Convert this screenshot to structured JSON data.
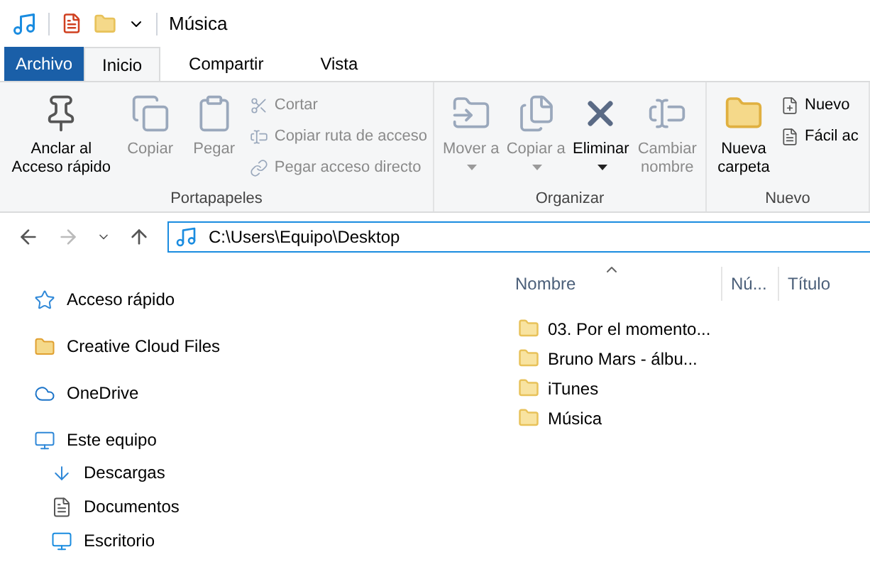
{
  "window": {
    "title": "Música"
  },
  "tabs": [
    {
      "label": "Archivo",
      "kind": "file",
      "selected": false
    },
    {
      "label": "Inicio",
      "kind": "tab",
      "selected": true
    },
    {
      "label": "Compartir",
      "kind": "tab",
      "selected": false
    },
    {
      "label": "Vista",
      "kind": "tab",
      "selected": false
    }
  ],
  "ribbon": {
    "groups": [
      {
        "label": "Portapapeles",
        "large": [
          {
            "label": "Anclar al Acceso rápido",
            "disabled": false
          },
          {
            "label": "Copiar",
            "disabled": true
          },
          {
            "label": "Pegar",
            "disabled": true
          }
        ],
        "small": [
          {
            "label": "Cortar",
            "disabled": true
          },
          {
            "label": "Copiar ruta de acceso",
            "disabled": true
          },
          {
            "label": "Pegar acceso directo",
            "disabled": true
          }
        ]
      },
      {
        "label": "Organizar",
        "large": [
          {
            "label": "Mover a",
            "disabled": true,
            "dropdown": true
          },
          {
            "label": "Copiar a",
            "disabled": true,
            "dropdown": true
          },
          {
            "label": "Eliminar",
            "disabled": false,
            "dropdown": true
          },
          {
            "label": "Cambiar nombre",
            "disabled": true,
            "dropdown": false
          }
        ]
      },
      {
        "label": "Nuevo",
        "large": [
          {
            "label": "Nueva carpeta",
            "disabled": false
          }
        ],
        "small": [
          {
            "label": "Nuevo",
            "disabled": false
          },
          {
            "label": "Fácil ac",
            "disabled": false
          }
        ]
      }
    ]
  },
  "address": {
    "value": "C:\\Users\\Equipo\\Desktop"
  },
  "nav": [
    {
      "label": "Acceso rápido"
    },
    {
      "label": "Creative Cloud Files"
    },
    {
      "label": "OneDrive"
    },
    {
      "label": "Este equipo",
      "children": [
        {
          "label": "Descargas"
        },
        {
          "label": "Documentos"
        },
        {
          "label": "Escritorio"
        }
      ]
    }
  ],
  "table": {
    "columns": [
      "Nombre",
      "Nú...",
      "Título"
    ],
    "rows": [
      {
        "name": "03. Por el momento..."
      },
      {
        "name": "Bruno Mars - álbu..."
      },
      {
        "name": "iTunes"
      },
      {
        "name": "Música"
      }
    ]
  }
}
